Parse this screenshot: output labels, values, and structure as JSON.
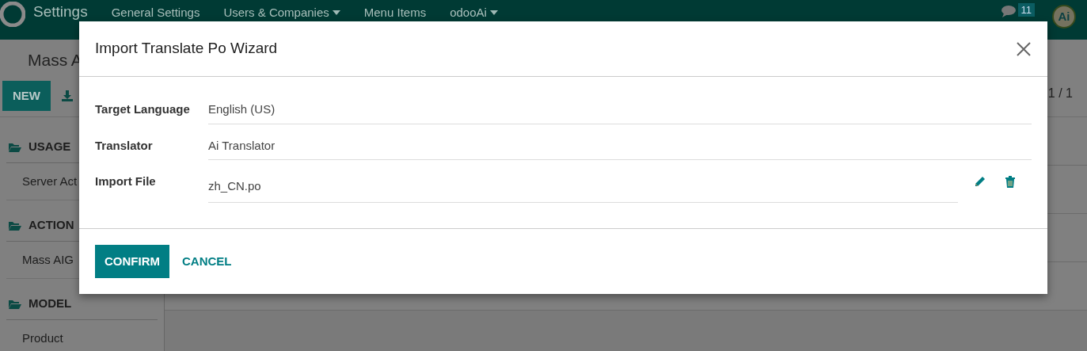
{
  "navbar": {
    "app": "Settings",
    "menus": [
      {
        "label": "General Settings",
        "dropdown": false
      },
      {
        "label": "Users & Companies",
        "dropdown": true
      },
      {
        "label": "Menu Items",
        "dropdown": false
      },
      {
        "label": "odooAi",
        "dropdown": true
      }
    ],
    "messages_count": "11",
    "avatar": "Ai"
  },
  "control_panel": {
    "breadcrumb": "Mass A",
    "new_button": "NEW",
    "pager": "1 / 1"
  },
  "sidebar": {
    "sections": [
      {
        "title": "USAGE",
        "items": [
          "Server Act"
        ]
      },
      {
        "title": "ACTION",
        "items": [
          "Mass AIG"
        ]
      },
      {
        "title": "MODEL",
        "items": [
          "Product"
        ]
      }
    ]
  },
  "dialog": {
    "title": "Import Translate Po Wizard",
    "fields": [
      {
        "label": "Target Language",
        "value": "English (US)",
        "kind": "text"
      },
      {
        "label": "Translator",
        "value": "Ai Translator",
        "kind": "text"
      },
      {
        "label": "Import File",
        "value": "zh_CN.po",
        "kind": "file"
      }
    ],
    "buttons": [
      {
        "label": "CONFIRM",
        "kind": "primary"
      },
      {
        "label": "CANCEL",
        "kind": "link"
      }
    ]
  }
}
